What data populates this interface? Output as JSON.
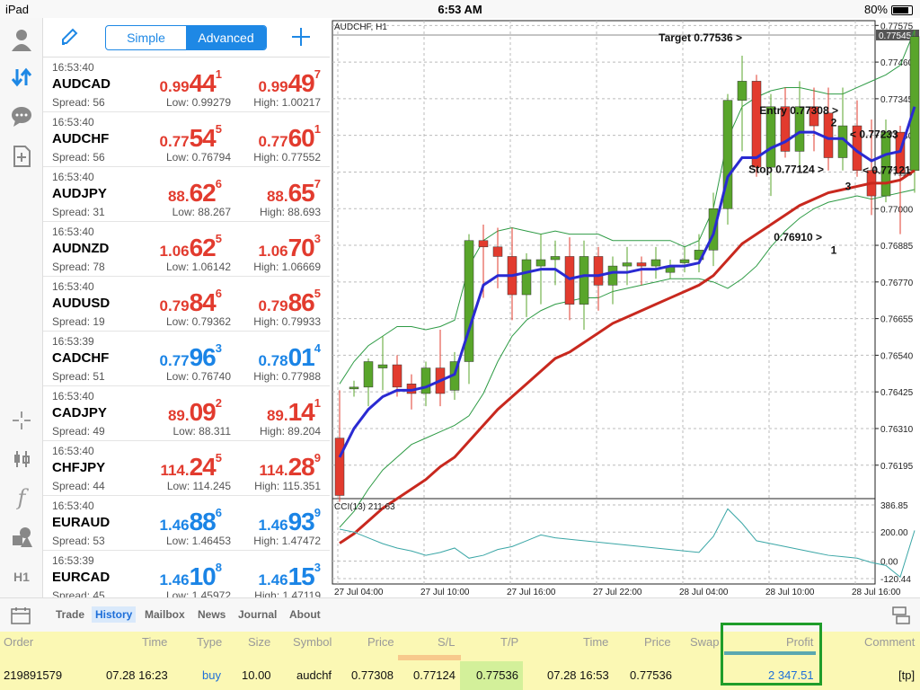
{
  "status": {
    "device": "iPad",
    "time": "6:53 AM",
    "battery": "80%"
  },
  "segment": {
    "simple": "Simple",
    "advanced": "Advanced"
  },
  "quotes": [
    {
      "time": "16:53:40",
      "symbol": "AUDCAD",
      "spread": "Spread: 56",
      "low": "Low: 0.99279",
      "high": "High: 1.00217",
      "bid": [
        "0.99",
        "44",
        "1"
      ],
      "ask": [
        "0.99",
        "49",
        "7"
      ],
      "color": "red"
    },
    {
      "time": "16:53:40",
      "symbol": "AUDCHF",
      "spread": "Spread: 56",
      "low": "Low: 0.76794",
      "high": "High: 0.77552",
      "bid": [
        "0.77",
        "54",
        "5"
      ],
      "ask": [
        "0.77",
        "60",
        "1"
      ],
      "color": "red"
    },
    {
      "time": "16:53:40",
      "symbol": "AUDJPY",
      "spread": "Spread: 31",
      "low": "Low: 88.267",
      "high": "High: 88.693",
      "bid": [
        "88.",
        "62",
        "6"
      ],
      "ask": [
        "88.",
        "65",
        "7"
      ],
      "color": "red"
    },
    {
      "time": "16:53:40",
      "symbol": "AUDNZD",
      "spread": "Spread: 78",
      "low": "Low: 1.06142",
      "high": "High: 1.06669",
      "bid": [
        "1.06",
        "62",
        "5"
      ],
      "ask": [
        "1.06",
        "70",
        "3"
      ],
      "color": "red"
    },
    {
      "time": "16:53:40",
      "symbol": "AUDUSD",
      "spread": "Spread: 19",
      "low": "Low: 0.79362",
      "high": "High: 0.79933",
      "bid": [
        "0.79",
        "84",
        "6"
      ],
      "ask": [
        "0.79",
        "86",
        "5"
      ],
      "color": "red"
    },
    {
      "time": "16:53:39",
      "symbol": "CADCHF",
      "spread": "Spread: 51",
      "low": "Low: 0.76740",
      "high": "High: 0.77988",
      "bid": [
        "0.77",
        "96",
        "3"
      ],
      "ask": [
        "0.78",
        "01",
        "4"
      ],
      "color": "blue"
    },
    {
      "time": "16:53:40",
      "symbol": "CADJPY",
      "spread": "Spread: 49",
      "low": "Low: 88.311",
      "high": "High: 89.204",
      "bid": [
        "89.",
        "09",
        "2"
      ],
      "ask": [
        "89.",
        "14",
        "1"
      ],
      "color": "red"
    },
    {
      "time": "16:53:40",
      "symbol": "CHFJPY",
      "spread": "Spread: 44",
      "low": "Low: 114.245",
      "high": "High: 115.351",
      "bid": [
        "114.",
        "24",
        "5"
      ],
      "ask": [
        "114.",
        "28",
        "9"
      ],
      "color": "red"
    },
    {
      "time": "16:53:40",
      "symbol": "EURAUD",
      "spread": "Spread: 53",
      "low": "Low: 1.46453",
      "high": "High: 1.47472",
      "bid": [
        "1.46",
        "88",
        "6"
      ],
      "ask": [
        "1.46",
        "93",
        "9"
      ],
      "color": "blue"
    },
    {
      "time": "16:53:39",
      "symbol": "EURCAD",
      "spread": "Spread: 45",
      "low": "Low: 1.45972",
      "high": "High: 1.47119",
      "bid": [
        "1.46",
        "10",
        "8"
      ],
      "ask": [
        "1.46",
        "15",
        "3"
      ],
      "color": "blue"
    }
  ],
  "chart_data": {
    "type": "candlestick",
    "title": "AUDCHF, H1",
    "price_ticks": [
      "0.77575",
      "0.77460",
      "0.77345",
      "0.77230",
      "0.77115",
      "0.77000",
      "0.76885",
      "0.76770",
      "0.76655",
      "0.76540",
      "0.76425",
      "0.76310",
      "0.76195"
    ],
    "price_range": [
      0.7609,
      0.7759
    ],
    "current_price": "0.77545",
    "time_ticks": [
      "27 Jul 04:00",
      "27 Jul 10:00",
      "27 Jul 16:00",
      "27 Jul 22:00",
      "28 Jul 04:00",
      "28 Jul 10:00",
      "28 Jul 16:00"
    ],
    "candles": [
      {
        "o": 0.7628,
        "h": 0.7643,
        "l": 0.7608,
        "c": 0.761
      },
      {
        "o": 0.7644,
        "h": 0.7646,
        "l": 0.7641,
        "c": 0.7644
      },
      {
        "o": 0.7644,
        "h": 0.7653,
        "l": 0.7638,
        "c": 0.7652
      },
      {
        "o": 0.765,
        "h": 0.766,
        "l": 0.7643,
        "c": 0.7651
      },
      {
        "o": 0.7651,
        "h": 0.7654,
        "l": 0.7641,
        "c": 0.7644
      },
      {
        "o": 0.7645,
        "h": 0.7648,
        "l": 0.7637,
        "c": 0.7642
      },
      {
        "o": 0.7642,
        "h": 0.7652,
        "l": 0.7638,
        "c": 0.765
      },
      {
        "o": 0.765,
        "h": 0.7662,
        "l": 0.7638,
        "c": 0.7642
      },
      {
        "o": 0.7643,
        "h": 0.7655,
        "l": 0.764,
        "c": 0.7652
      },
      {
        "o": 0.7652,
        "h": 0.7692,
        "l": 0.7645,
        "c": 0.769
      },
      {
        "o": 0.769,
        "h": 0.7695,
        "l": 0.7672,
        "c": 0.7688
      },
      {
        "o": 0.7688,
        "h": 0.7694,
        "l": 0.7675,
        "c": 0.7685
      },
      {
        "o": 0.7685,
        "h": 0.7694,
        "l": 0.7665,
        "c": 0.7673
      },
      {
        "o": 0.7673,
        "h": 0.7686,
        "l": 0.7666,
        "c": 0.7684
      },
      {
        "o": 0.7682,
        "h": 0.7692,
        "l": 0.767,
        "c": 0.7684
      },
      {
        "o": 0.7684,
        "h": 0.769,
        "l": 0.7676,
        "c": 0.7685
      },
      {
        "o": 0.7685,
        "h": 0.7691,
        "l": 0.7665,
        "c": 0.767
      },
      {
        "o": 0.767,
        "h": 0.769,
        "l": 0.7662,
        "c": 0.7685
      },
      {
        "o": 0.7685,
        "h": 0.7688,
        "l": 0.7668,
        "c": 0.7676
      },
      {
        "o": 0.7676,
        "h": 0.7685,
        "l": 0.767,
        "c": 0.7682
      },
      {
        "o": 0.7682,
        "h": 0.7688,
        "l": 0.7676,
        "c": 0.7683
      },
      {
        "o": 0.7683,
        "h": 0.7685,
        "l": 0.7676,
        "c": 0.7682
      },
      {
        "o": 0.7682,
        "h": 0.7688,
        "l": 0.7678,
        "c": 0.7684
      },
      {
        "o": 0.768,
        "h": 0.7684,
        "l": 0.7678,
        "c": 0.7682
      },
      {
        "o": 0.7683,
        "h": 0.7688,
        "l": 0.768,
        "c": 0.7684
      },
      {
        "o": 0.7684,
        "h": 0.7692,
        "l": 0.768,
        "c": 0.7687
      },
      {
        "o": 0.7687,
        "h": 0.7705,
        "l": 0.7682,
        "c": 0.77
      },
      {
        "o": 0.77,
        "h": 0.7736,
        "l": 0.7695,
        "c": 0.7734
      },
      {
        "o": 0.7734,
        "h": 0.7748,
        "l": 0.7718,
        "c": 0.774
      },
      {
        "o": 0.774,
        "h": 0.7742,
        "l": 0.771,
        "c": 0.7713
      },
      {
        "o": 0.7713,
        "h": 0.7736,
        "l": 0.7704,
        "c": 0.7732
      },
      {
        "o": 0.7732,
        "h": 0.7738,
        "l": 0.7716,
        "c": 0.7718
      },
      {
        "o": 0.7718,
        "h": 0.774,
        "l": 0.7712,
        "c": 0.7732
      },
      {
        "o": 0.7732,
        "h": 0.7738,
        "l": 0.7718,
        "c": 0.7726
      },
      {
        "o": 0.773,
        "h": 0.7738,
        "l": 0.7712,
        "c": 0.7716
      },
      {
        "o": 0.7716,
        "h": 0.7738,
        "l": 0.7712,
        "c": 0.7726
      },
      {
        "o": 0.7726,
        "h": 0.7734,
        "l": 0.771,
        "c": 0.7712
      },
      {
        "o": 0.7712,
        "h": 0.7728,
        "l": 0.7698,
        "c": 0.7704
      },
      {
        "o": 0.7704,
        "h": 0.7728,
        "l": 0.7702,
        "c": 0.7724
      },
      {
        "o": 0.7724,
        "h": 0.7726,
        "l": 0.7692,
        "c": 0.7711
      },
      {
        "o": 0.7712,
        "h": 0.7756,
        "l": 0.7705,
        "c": 0.7754
      }
    ],
    "ema_fast": [
      0.7622,
      0.7631,
      0.7637,
      0.7641,
      0.7643,
      0.7643,
      0.7644,
      0.7646,
      0.7648,
      0.7662,
      0.7676,
      0.7679,
      0.7679,
      0.768,
      0.7681,
      0.7681,
      0.7678,
      0.7679,
      0.7679,
      0.768,
      0.768,
      0.7681,
      0.7681,
      0.7682,
      0.7682,
      0.7683,
      0.7692,
      0.771,
      0.7716,
      0.7716,
      0.7719,
      0.7721,
      0.7724,
      0.7724,
      0.7722,
      0.7722,
      0.7718,
      0.7715,
      0.7717,
      0.7718,
      0.7732
    ],
    "ema_slow": [
      0.7595,
      0.7598,
      0.7602,
      0.7606,
      0.7609,
      0.7612,
      0.7615,
      0.7619,
      0.7622,
      0.7627,
      0.7632,
      0.7637,
      0.7641,
      0.7645,
      0.7649,
      0.7653,
      0.7655,
      0.7658,
      0.7661,
      0.7664,
      0.7666,
      0.7668,
      0.767,
      0.7672,
      0.7674,
      0.7676,
      0.7679,
      0.7684,
      0.7689,
      0.7692,
      0.7695,
      0.7698,
      0.7701,
      0.7703,
      0.7705,
      0.7706,
      0.7707,
      0.7708,
      0.7708,
      0.7709,
      0.7712
    ],
    "bb_upper": [
      0.7645,
      0.7652,
      0.7657,
      0.766,
      0.7663,
      0.7663,
      0.7662,
      0.7663,
      0.7665,
      0.7682,
      0.769,
      0.7693,
      0.7694,
      0.7693,
      0.7692,
      0.7693,
      0.7692,
      0.7692,
      0.7692,
      0.769,
      0.769,
      0.769,
      0.769,
      0.769,
      0.7688,
      0.769,
      0.77,
      0.7722,
      0.7732,
      0.7735,
      0.7737,
      0.7738,
      0.7738,
      0.7737,
      0.7736,
      0.7736,
      0.7738,
      0.774,
      0.7742,
      0.7745,
      0.7756
    ],
    "bb_lower": [
      0.76,
      0.7605,
      0.7612,
      0.7618,
      0.7622,
      0.7626,
      0.7628,
      0.763,
      0.7632,
      0.7635,
      0.7642,
      0.7652,
      0.766,
      0.7665,
      0.7668,
      0.767,
      0.7671,
      0.7672,
      0.7672,
      0.7674,
      0.7675,
      0.7676,
      0.7677,
      0.7678,
      0.7678,
      0.7678,
      0.7677,
      0.7675,
      0.7678,
      0.7682,
      0.7688,
      0.7693,
      0.7697,
      0.77,
      0.7702,
      0.7703,
      0.7704,
      0.7703,
      0.7704,
      0.7705,
      0.7706
    ],
    "annotations": [
      {
        "text": "Target 0.77536 >",
        "price": 0.77536
      },
      {
        "text": "Entry 0.77308 >",
        "price": 0.77308
      },
      {
        "text": "< 0.77233",
        "price": 0.77233
      },
      {
        "text": "Stop 0.77124 >",
        "price": 0.77124
      },
      {
        "text": "< 0.77121",
        "price": 0.77121
      },
      {
        "text": "0.76910 >",
        "price": 0.7691
      },
      {
        "text": "1",
        "price": 0.7687
      },
      {
        "text": "2",
        "price": 0.7727
      },
      {
        "text": "3",
        "price": 0.7707
      }
    ],
    "cci": {
      "label": "CCI(13) 211.63",
      "ticks": [
        "386.85",
        "200.00",
        "0.00",
        "-120.44"
      ],
      "range": [
        -120.44,
        386.85
      ],
      "values": [
        220,
        200,
        160,
        120,
        90,
        70,
        40,
        60,
        90,
        20,
        40,
        80,
        100,
        140,
        180,
        160,
        150,
        140,
        130,
        120,
        110,
        100,
        90,
        80,
        70,
        60,
        170,
        360,
        260,
        140,
        120,
        100,
        80,
        60,
        40,
        30,
        20,
        -10,
        -30,
        -110,
        211
      ]
    }
  },
  "tabs": [
    "Trade",
    "History",
    "Mailbox",
    "News",
    "Journal",
    "About"
  ],
  "active_tab": "History",
  "history": {
    "headers": [
      "Order",
      "Time",
      "Type",
      "Size",
      "Symbol",
      "Price",
      "S/L",
      "T/P",
      "Time",
      "Price",
      "Swap",
      "Profit",
      "Comment"
    ],
    "row": [
      "219891579",
      "07.28 16:23",
      "buy",
      "10.00",
      "audchf",
      "0.77308",
      "0.77124",
      "0.77536",
      "07.28 16:53",
      "0.77536",
      "",
      "2 347.51",
      "[tp]"
    ]
  },
  "colors": {
    "accent": "#1e88e5",
    "bull": "#59a52b",
    "bear": "#e23b2e",
    "ema_fast": "#2a2ad2",
    "ema_slow": "#c8281e",
    "band": "#2e9b45",
    "highlight": "#1f9d2a",
    "history_bg": "#fbf8b4"
  }
}
